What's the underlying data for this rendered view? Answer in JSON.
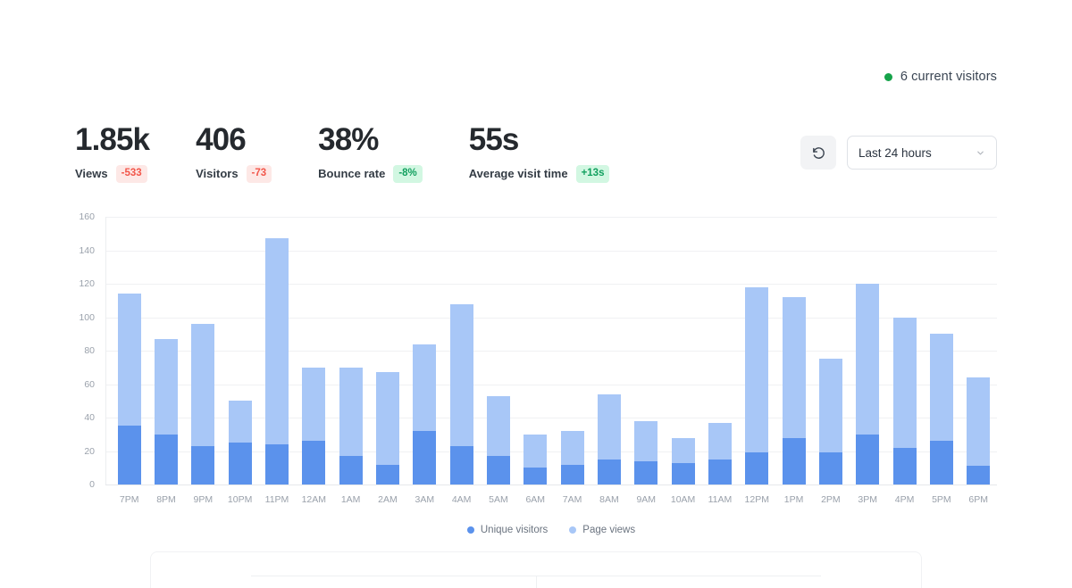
{
  "live": {
    "dot_color": "#16a34a",
    "text": "6 current visitors"
  },
  "stats": [
    {
      "value": "1.85k",
      "label": "Views",
      "badge": "-533",
      "badge_tone": "neg"
    },
    {
      "value": "406",
      "label": "Visitors",
      "badge": "-73",
      "badge_tone": "neg"
    },
    {
      "value": "38%",
      "label": "Bounce rate",
      "badge": "-8%",
      "badge_tone": "pos"
    },
    {
      "value": "55s",
      "label": "Average visit time",
      "badge": "+13s",
      "badge_tone": "pos"
    }
  ],
  "controls": {
    "refresh_icon": "refresh-icon",
    "range_value": "Last 24 hours",
    "chevron_icon": "chevron-down-icon"
  },
  "chart_data": {
    "type": "bar",
    "title": "",
    "xlabel": "",
    "ylabel": "",
    "stacked": true,
    "grid": true,
    "legend_position": "bottom",
    "ylim": [
      0,
      160
    ],
    "yticks": [
      0,
      20,
      40,
      60,
      80,
      100,
      120,
      140,
      160
    ],
    "categories": [
      "7PM",
      "8PM",
      "9PM",
      "10PM",
      "11PM",
      "12AM",
      "1AM",
      "2AM",
      "3AM",
      "4AM",
      "5AM",
      "6AM",
      "7AM",
      "8AM",
      "9AM",
      "10AM",
      "11AM",
      "12PM",
      "1PM",
      "2PM",
      "3PM",
      "4PM",
      "5PM",
      "6PM"
    ],
    "series": [
      {
        "name": "Unique visitors",
        "color": "#5b92ec",
        "values": [
          35,
          30,
          23,
          25,
          24,
          26,
          17,
          12,
          32,
          23,
          17,
          10,
          12,
          15,
          14,
          13,
          15,
          19,
          28,
          19,
          30,
          22,
          26,
          11
        ]
      },
      {
        "name": "Page views",
        "color": "#a8c7f7",
        "values": [
          114,
          87,
          96,
          50,
          147,
          70,
          70,
          67,
          84,
          108,
          53,
          30,
          32,
          54,
          38,
          28,
          37,
          118,
          112,
          75,
          120,
          100,
          90,
          64
        ]
      }
    ]
  }
}
